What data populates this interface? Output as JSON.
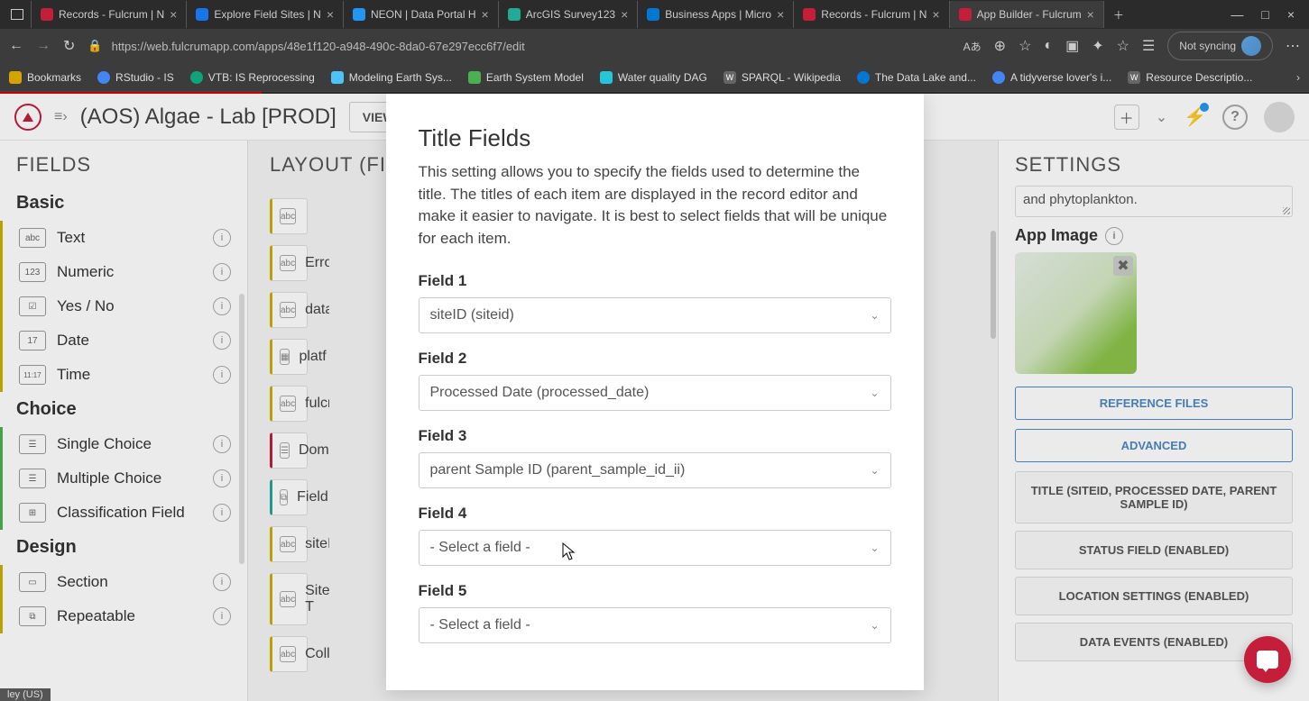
{
  "browser": {
    "tabs": [
      {
        "title": "Records - Fulcrum | N",
        "color": "#c41e3a"
      },
      {
        "title": "Explore Field Sites | N",
        "color": "#1a73e8"
      },
      {
        "title": "NEON | Data Portal H",
        "color": "#2196f3"
      },
      {
        "title": "ArcGIS Survey123",
        "color": "#22aa99"
      },
      {
        "title": "Business Apps | Micro",
        "color": "#0078d4"
      },
      {
        "title": "Records - Fulcrum | N",
        "color": "#c41e3a"
      },
      {
        "title": "App Builder - Fulcrum",
        "color": "#c41e3a",
        "active": true
      }
    ],
    "url": "https://web.fulcrumapp.com/apps/48e1f120-a948-490c-8da0-67e297ecc6f7/edit",
    "sync_label": "Not syncing",
    "bookmarks": [
      {
        "label": "Bookmarks",
        "color": "#d6a400"
      },
      {
        "label": "RStudio - IS",
        "color": "#4285f4"
      },
      {
        "label": "VTB: IS Reprocessing",
        "color": "#0ea47a"
      },
      {
        "label": "Modeling Earth Sys...",
        "color": "#4fc3f7"
      },
      {
        "label": "Earth System Model",
        "color": "#4caf50"
      },
      {
        "label": "Water quality DAG",
        "color": "#26c6da"
      },
      {
        "label": "SPARQL - Wikipedia",
        "color": "#ffffff"
      },
      {
        "label": "The Data Lake and...",
        "color": "#0078d4"
      },
      {
        "label": "A tidyverse lover's i...",
        "color": "#4285f4"
      },
      {
        "label": "Resource Descriptio...",
        "color": "#ffffff"
      }
    ]
  },
  "app": {
    "title": "(AOS) Algae - Lab [PROD]",
    "view_records": "VIEW RECORDS"
  },
  "fields_panel": {
    "header": "FIELDS",
    "groups": {
      "basic": "Basic",
      "choice": "Choice",
      "design": "Design"
    },
    "items": {
      "text": "Text",
      "numeric": "Numeric",
      "yesno": "Yes / No",
      "date": "Date",
      "time": "Time",
      "single_choice": "Single Choice",
      "multiple_choice": "Multiple Choice",
      "classification": "Classification Field",
      "section": "Section",
      "repeatable": "Repeatable"
    }
  },
  "layout_panel": {
    "header": "LAYOUT  (FIE",
    "items": [
      "",
      "Erro",
      "data",
      "platf",
      "fulcr",
      "Dom",
      "Field",
      "siteI",
      "Site T",
      "Colle"
    ]
  },
  "settings_panel": {
    "header": "SETTINGS",
    "desc": "and phytoplankton.",
    "app_image_label": "App Image",
    "btn_reference": "REFERENCE FILES",
    "btn_advanced": "ADVANCED",
    "btn_title": "TITLE (SITEID, PROCESSED DATE, PARENT SAMPLE ID)",
    "btn_status": "STATUS FIELD (ENABLED)",
    "btn_location": "LOCATION SETTINGS (ENABLED)",
    "btn_events": "DATA EVENTS (ENABLED)"
  },
  "modal": {
    "title": "Title Fields",
    "desc": "This setting allows you to specify the fields used to determine the title. The titles of each item are displayed in the record editor and make it easier to navigate. It is best to select fields that will be unique for each item.",
    "fields": [
      {
        "label": "Field 1",
        "value": "siteID (siteid)"
      },
      {
        "label": "Field 2",
        "value": "Processed Date (processed_date)"
      },
      {
        "label": "Field 3",
        "value": "parent Sample ID (parent_sample_id_ii)"
      },
      {
        "label": "Field 4",
        "value": "- Select a field -"
      },
      {
        "label": "Field 5",
        "value": "- Select a field -"
      }
    ]
  },
  "status": "ley (US)"
}
